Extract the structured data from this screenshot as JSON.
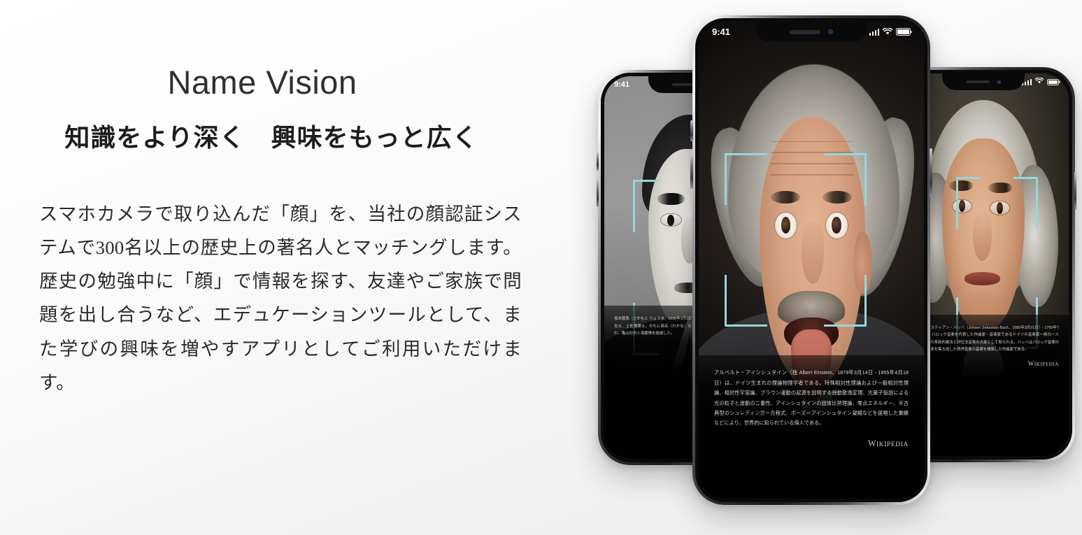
{
  "hero": {
    "brand_title": "Name Vision",
    "tagline": "知識をより深く　興味をもっと広く",
    "description": "スマホカメラで取り込んだ「顔」を、当社の顔認証システムで300名以上の歴史上の著名人とマッチングします。歴史の勉強中に「顔」で情報を探す、友達やご家族で問題を出し合うなど、エデュケーションツールとして、また学びの興味を増やすアプリとしてご利用いただけます。"
  },
  "phones": {
    "center": {
      "person": "アルベルト・アインシュタイン",
      "status_time": "9:41",
      "info_text": "アルベルト・アインシュタイン（独 Albert Einstein、1879年3月14日 - 1955年4月18日）は、ドイツ生まれの理論物理学者である。特殊相対性理論および一般相対性理論、相対性宇宙論、ブラウン運動の起源を説明する揺動散逸定理、光量子仮説による光の粒子と波動の二重性、アインシュタインの固体比熱理論、零点エネルギー、半古典型のシュレディンガー方程式、ボーズ＝アインシュタイン凝縮などを提唱した業績などにより、世界的に知られている偉人である。",
      "source_cap": "W",
      "source_rest": "IKIPEDIA"
    },
    "left": {
      "person": "坂本龍馬",
      "status_time": "9:41",
      "info_text": "坂本龍馬（さかもと りょうま、1836年1月3日） 通称は才谷梅太郎）は、江戸時代末期の志士、土佐藩郷士。のちに商名（わかな）などの変名がある。才谷屋を営む商家に生まれ、亀山社中と海援隊を結成した。"
    },
    "right": {
      "person": "ヨハン・ゼバスティアン・バッハ",
      "info_text": "ヨハン・ゼバスティアン・バッハ（Johann Sebastian Bach、1685年3月21日）- 1750年7月28日）は、バロック音楽を代表した作曲家・音楽家であるドイツの音楽家一族の一人で、鍵盤楽器の革新的奏法と対位法音楽の大家として知られる。バッハはバロック音楽のそれまでの音楽を集大成した西洋音楽の基礎を構築した作曲家である。",
      "source_cap": "W",
      "source_rest": "IKIPEDIA"
    }
  },
  "icons": {
    "signal": "signal-bars-icon",
    "wifi": "wifi-icon",
    "battery": "battery-icon",
    "face_bracket": "face-detect-bracket-icon"
  },
  "colors": {
    "face_bracket": "#96d6dc",
    "text_dark": "#1d1d1b",
    "title_gray": "#30302f",
    "background_top": "#ffffff",
    "background_bottom": "#ececec"
  }
}
